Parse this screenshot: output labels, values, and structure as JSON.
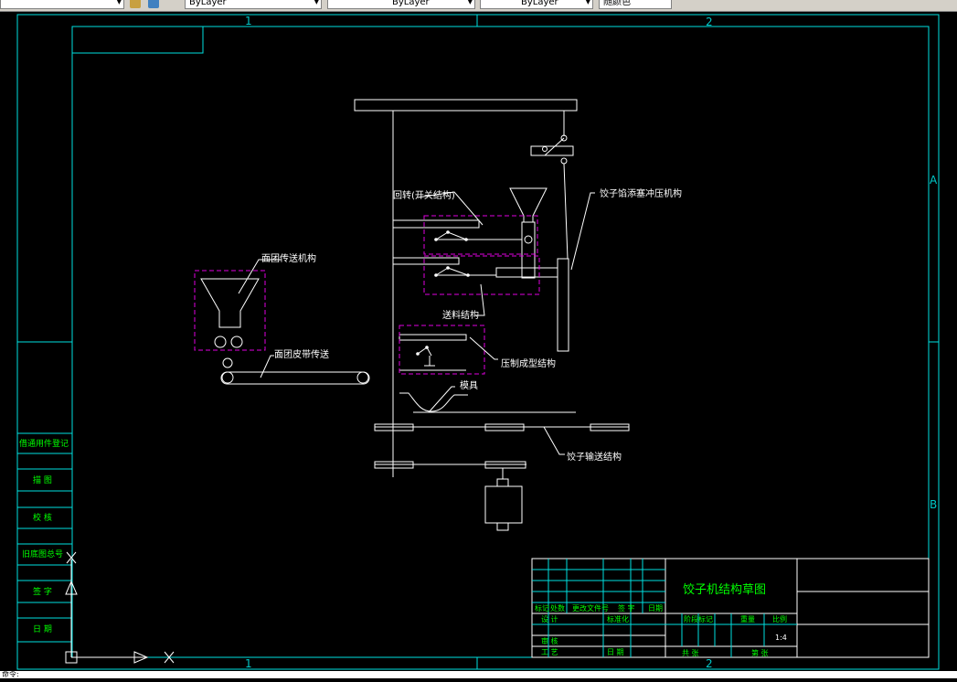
{
  "toolbar": {
    "layer_linetype": "ByLayer",
    "layer_lineweight": "ByLayer",
    "layer_plotstyle": "ByLayer",
    "color_control": "随颜色"
  },
  "frame": {
    "column_labels": [
      "1",
      "2"
    ],
    "row_labels": [
      "A",
      "B"
    ]
  },
  "labels": {
    "rotary_switch": "回转(开关结构)",
    "dumpling_filling": "饺子馅添塞冲压机构",
    "dough_conveyor": "面团传送机构",
    "feeding": "送料结构",
    "dough_belt": "面团皮带传送",
    "press_forming": "压制成型结构",
    "mold": "模具",
    "dumpling_conveyor": "饺子输送结构"
  },
  "left_table": {
    "rows": [
      "借通用件登记",
      "描 图",
      "校 核",
      "旧底图总号",
      "签 字",
      "日 期"
    ]
  },
  "title_block": {
    "title": "饺子机结构草图",
    "row_labels": [
      "标记",
      "处数",
      "更改文件号",
      "签 字",
      "日期"
    ],
    "design": "设 计",
    "standardization": "标准化",
    "stage_mark": "阶段标记",
    "weight": "重量",
    "scale_label": "比例",
    "scale": "1:4",
    "review": "审 核",
    "process": "工 艺",
    "date": "日 期",
    "sheets": "共 张",
    "sheet_no": "第 张"
  },
  "command_line": "命令:"
}
